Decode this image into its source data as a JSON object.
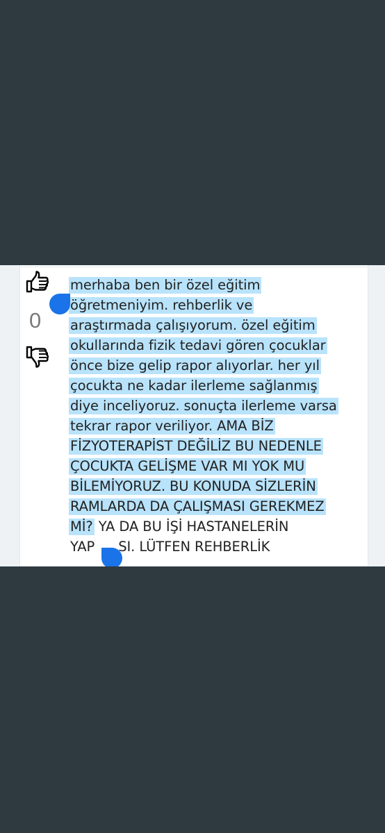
{
  "vote": {
    "score": "0",
    "upvote_icon": "thumbs-up-icon",
    "downvote_icon": "thumbs-down-icon"
  },
  "comment": {
    "lines": [
      "merhaba ben bir özel eğitim",
      "öğretmeniyim. rehberlik ve",
      "araştırmada çalışıyorum. özel eğitim",
      "okullarında fizik tedavi gören çocuklar",
      "önce bize gelip rapor alıyorlar. her yıl",
      "çocukta ne kadar ilerleme sağlanmış",
      "diye inceliyoruz. sonuçta ilerleme varsa",
      "tekrar rapor veriliyor. AMA BİZ",
      "FİZYOTERAPİST DEĞİLİZ BU NEDENLE",
      "ÇOCUKTA GELİŞME VAR MI YOK MU",
      "BİLEMİYORUZ. BU KONUDA SİZLERİN",
      "RAMLARDA DA ÇALIŞMASI GEREKMEZ",
      "Mİ?",
      "YA DA BU İŞİ HASTANELERİN",
      "YAP",
      "SI. LÜTFEN REHBERLİK"
    ]
  },
  "colors": {
    "background": "#2e3a40",
    "highlight": "#b9e3fb",
    "selection_handle": "#1a73e8",
    "score_text": "#7a7a7a"
  }
}
